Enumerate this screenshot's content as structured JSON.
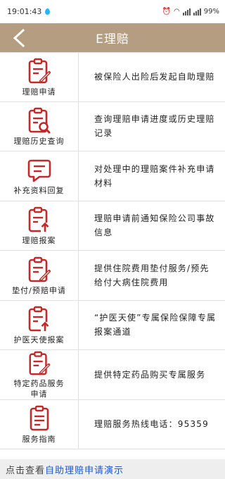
{
  "status_bar": {
    "time": "19:01:43",
    "battery": "99%"
  },
  "header": {
    "title": "E理赔"
  },
  "items": [
    {
      "label": "理赔申请",
      "desc": "被保险人出险后发起自助理赔",
      "icon": "claim-form-pen-icon"
    },
    {
      "label": "理赔历史查询",
      "desc": "查询理赔申请进度或历史理赔记录",
      "icon": "claim-history-search-icon"
    },
    {
      "label": "补充资料回复",
      "desc": "对处理中的理赔案件补充申请材料",
      "icon": "message-bubble-icon"
    },
    {
      "label": "理赔报案",
      "desc": "理赔申请前通知保险公司事故信息",
      "icon": "claim-report-upload-icon"
    },
    {
      "label": "垫付/预赔申请",
      "desc": "提供住院费用垫付服务/预先给付大病住院费用",
      "icon": "advance-payment-pen-icon"
    },
    {
      "label": "护医天使报案",
      "desc": "“护医天使”专属保险保障专属报案通道",
      "icon": "angel-report-upload-icon"
    },
    {
      "label": "特定药品服务申请",
      "desc": "提供特定药品购买专属服务",
      "icon": "drug-service-pen-icon"
    },
    {
      "label": "服务指南",
      "desc": "理赔服务热线电话：95359",
      "icon": "service-guide-icon"
    }
  ],
  "footer": {
    "prefix": "点击查看",
    "link": "自助理赔申请演示"
  },
  "colors": {
    "header_bg": "#b49d80",
    "icon_red": "#c62828",
    "link_blue": "#1e5bd0"
  }
}
